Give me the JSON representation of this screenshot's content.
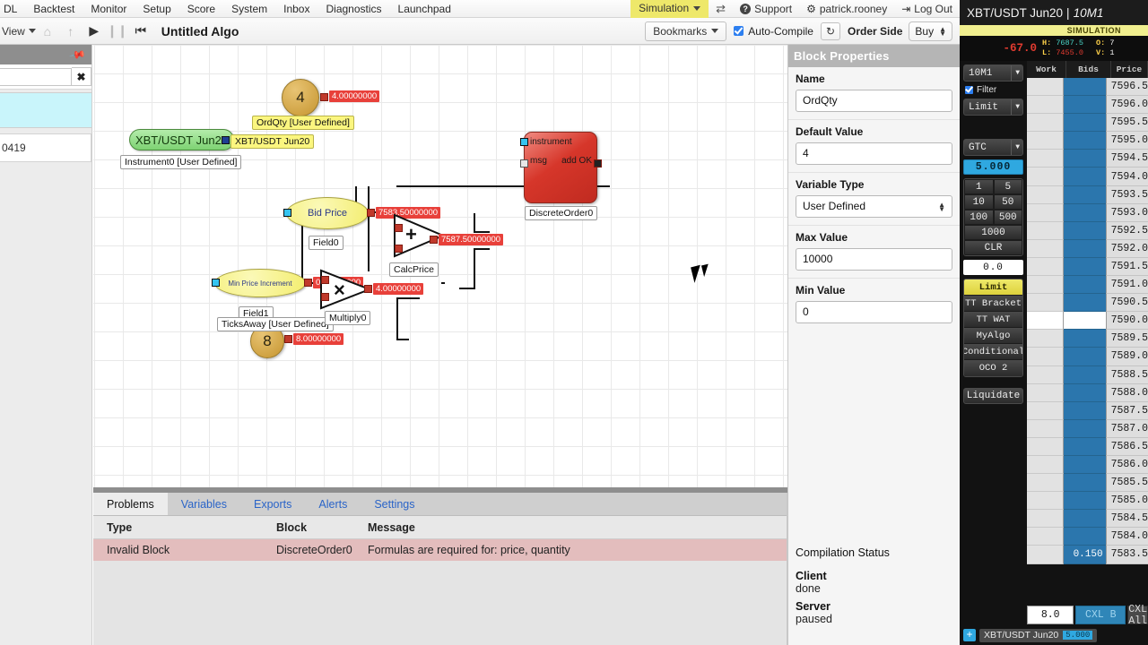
{
  "menubar": {
    "items": [
      "DL",
      "Backtest",
      "Monitor",
      "Setup",
      "Score",
      "System",
      "Inbox",
      "Diagnostics",
      "Launchpad"
    ],
    "mode": "Simulation",
    "support": "Support",
    "user": "patrick.rooney",
    "logout": "Log Out"
  },
  "toolbar": {
    "view": "View",
    "title": "Untitled Algo",
    "bookmarks": "Bookmarks",
    "autocompile": "Auto-Compile",
    "order_side_label": "Order Side",
    "order_side_value": "Buy"
  },
  "leftbar": {
    "row_value": "0419"
  },
  "canvas": {
    "nodes": [
      {
        "id": "ordqty",
        "caption": "4",
        "label": "OrdQty [User Defined]",
        "value": "4.00000000"
      },
      {
        "id": "instrument0",
        "caption": "XBT/USDT Jun20",
        "label": "Instrument0 [User Defined]",
        "value": "XBT/USDT Jun20"
      },
      {
        "id": "field0",
        "caption": "Bid Price",
        "label": "Field0",
        "value": "7583.50000000"
      },
      {
        "id": "field1",
        "caption": "Min Price Increment",
        "label": "Field1",
        "value": "0.50000000"
      },
      {
        "id": "ticksaway",
        "caption": "8",
        "label": "TicksAway [User Defined]",
        "value": "8.00000000"
      },
      {
        "id": "multiply0",
        "caption": "×",
        "label": "Multiply0",
        "value": "4.00000000"
      },
      {
        "id": "calcprice",
        "caption": "+",
        "label": "CalcPrice",
        "value": "7587.50000000"
      },
      {
        "id": "discreteorder0",
        "caption": "",
        "label": "DiscreteOrder0",
        "value": ""
      }
    ],
    "order_ports": {
      "instrument": "instrument",
      "msg": "msg",
      "add_ok": "add OK"
    }
  },
  "properties": {
    "title": "Block Properties",
    "fields": [
      {
        "label": "Name",
        "value": "OrdQty",
        "type": "text"
      },
      {
        "label": "Default Value",
        "value": "4",
        "type": "text"
      },
      {
        "label": "Variable Type",
        "value": "User Defined",
        "type": "select"
      },
      {
        "label": "Max Value",
        "value": "10000",
        "type": "text"
      },
      {
        "label": "Min Value",
        "value": "0",
        "type": "text"
      }
    ],
    "compilation": {
      "heading": "Compilation Status",
      "client_label": "Client",
      "client_value": "done",
      "server_label": "Server",
      "server_value": "paused"
    }
  },
  "bottom": {
    "tabs": [
      "Problems",
      "Variables",
      "Exports",
      "Alerts",
      "Settings"
    ],
    "active_tab": "Problems",
    "columns": [
      "Type",
      "Block",
      "Message"
    ],
    "rows": [
      {
        "type": "Invalid Block",
        "block": "DiscreteOrder0",
        "message": "Formulas are required for: price, quantity"
      }
    ]
  },
  "trading": {
    "title_symbol": "XBT/USDT Jun20",
    "title_sep": "|",
    "title_feed": "10M1",
    "simulation": "SIMULATION",
    "net_change": "-67.0",
    "high_key": "H:",
    "high": "7687.5",
    "low_key": "L:",
    "low": "7455.0",
    "open_key": "O:",
    "open": "7",
    "vol_key": "V:",
    "vol": "1",
    "feed_select": "10M1",
    "filter_label": "Filter",
    "order_type_select": "Limit",
    "tif_select": "GTC",
    "qty_display": "5.000",
    "qty_buttons": [
      "1",
      "5",
      "10",
      "50",
      "100",
      "500",
      "1000",
      "CLR"
    ],
    "offset_value": "0.0",
    "order_buttons": [
      "Limit",
      "TT Bracket",
      "TT WAT",
      "MyAlgo",
      "Conditional",
      "OCO 2"
    ],
    "order_active": "Limit",
    "liquidate": "Liquidate",
    "ladder_columns": [
      "Work",
      "Bids",
      "Price"
    ],
    "ladder_prices": [
      "7596.5",
      "7596.0",
      "7595.5",
      "7595.0",
      "7594.5",
      "7594.0",
      "7593.5",
      "7593.0",
      "7592.5",
      "7592.0",
      "7591.5",
      "7591.0",
      "7590.5",
      "7590.0",
      "7589.5",
      "7589.0",
      "7588.5",
      "7588.0",
      "7587.5",
      "7587.0",
      "7586.5",
      "7586.0",
      "7585.5",
      "7585.0",
      "7584.5",
      "7584.0",
      "7583.5"
    ],
    "ladder_mark_index": 13,
    "ladder_bid_qty_index": 26,
    "ladder_bid_qty": "0.150",
    "foot_qty": "8.0",
    "cancel_bid": "CXL B",
    "cancel_all": "CXL All",
    "footer_symbol": "XBT/USDT Jun20",
    "footer_qty": "5.000",
    "add_icon": "+"
  }
}
